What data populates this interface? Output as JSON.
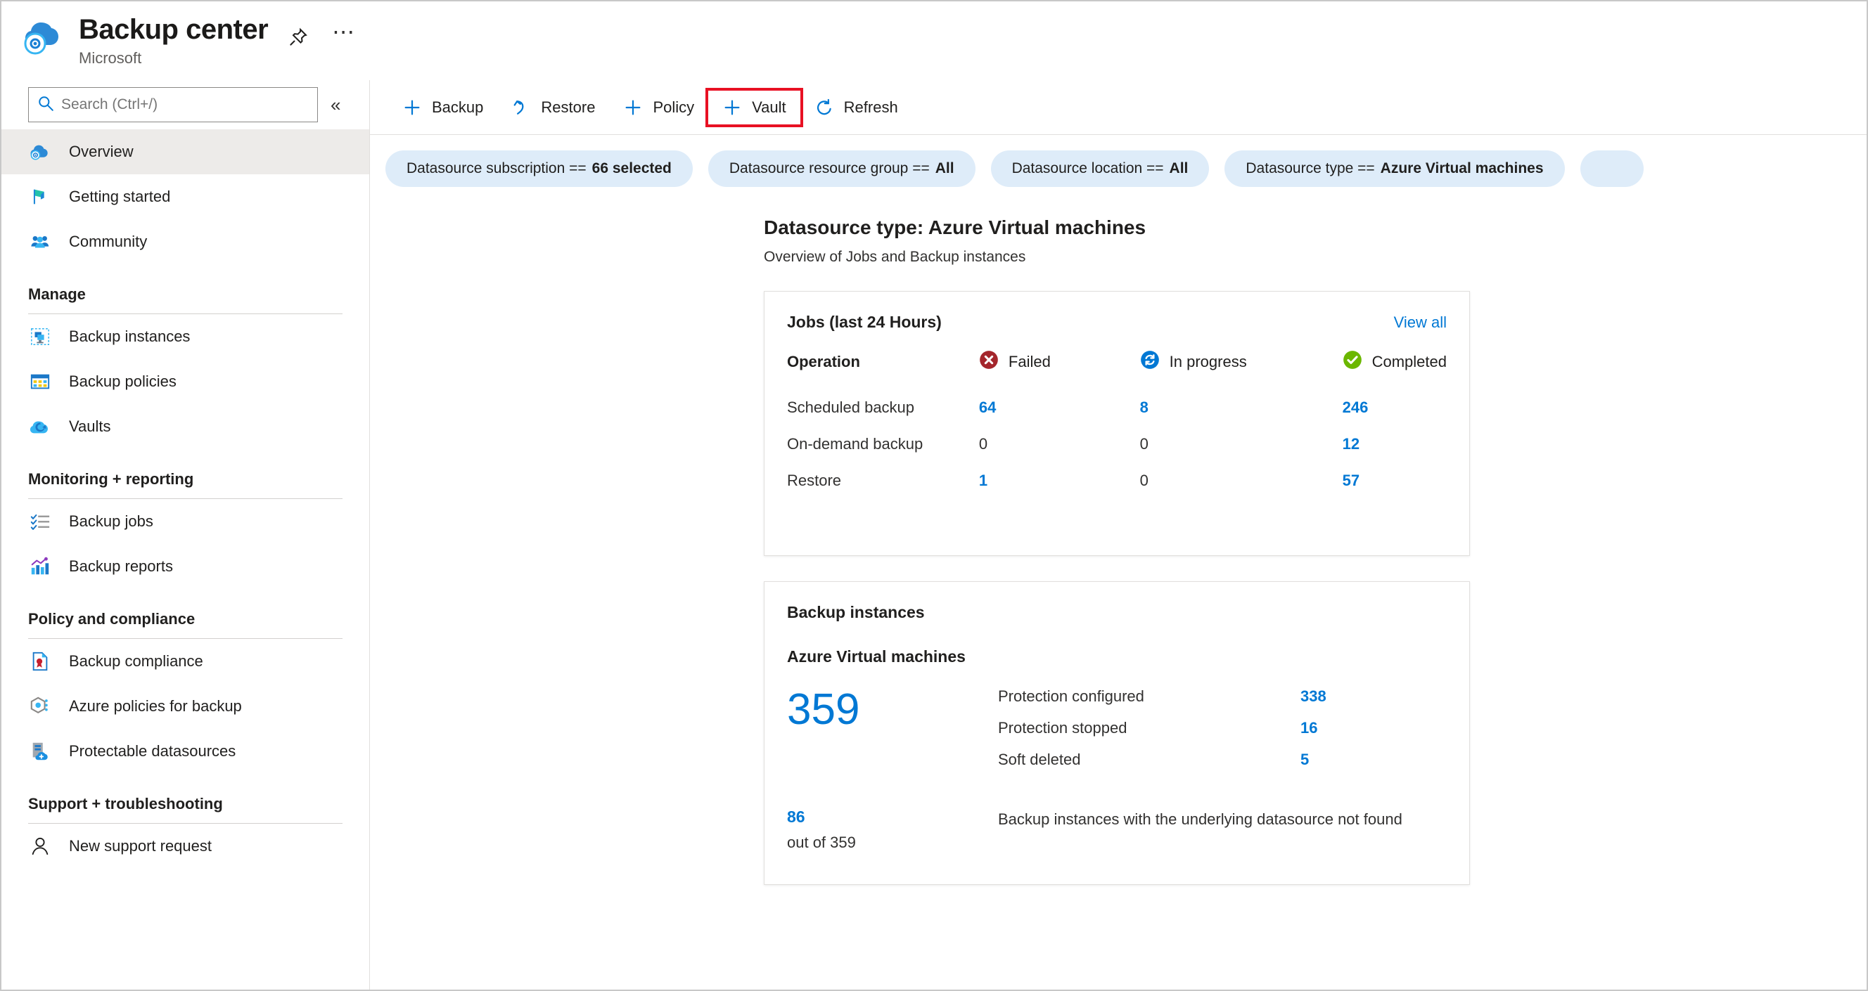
{
  "header": {
    "title": "Backup center",
    "subtitle": "Microsoft",
    "pin_icon": "pin-icon",
    "more_icon": "ellipsis-icon",
    "logo_icon": "backup-center-logo-icon"
  },
  "sidebar": {
    "search": {
      "placeholder": "Search (Ctrl+/)",
      "value": "",
      "icon": "search-icon"
    },
    "collapse_label": "«",
    "top_items": [
      {
        "label": "Overview",
        "icon": "backup-center-cloud-icon",
        "active": true
      },
      {
        "label": "Getting started",
        "icon": "flag-icon",
        "active": false
      },
      {
        "label": "Community",
        "icon": "people-icon",
        "active": false
      }
    ],
    "groups": [
      {
        "title": "Manage",
        "items": [
          {
            "label": "Backup instances",
            "icon": "backup-instances-icon"
          },
          {
            "label": "Backup policies",
            "icon": "backup-policies-icon"
          },
          {
            "label": "Vaults",
            "icon": "vault-cloud-icon"
          }
        ]
      },
      {
        "title": "Monitoring + reporting",
        "items": [
          {
            "label": "Backup jobs",
            "icon": "checklist-icon"
          },
          {
            "label": "Backup reports",
            "icon": "bar-chart-icon"
          }
        ]
      },
      {
        "title": "Policy and compliance",
        "items": [
          {
            "label": "Backup compliance",
            "icon": "compliance-document-icon"
          },
          {
            "label": "Azure policies for backup",
            "icon": "azure-policy-icon"
          },
          {
            "label": "Protectable datasources",
            "icon": "protectable-datasource-icon"
          }
        ]
      },
      {
        "title": "Support + troubleshooting",
        "items": [
          {
            "label": "New support request",
            "icon": "support-person-icon"
          }
        ]
      }
    ]
  },
  "toolbar": {
    "buttons": [
      {
        "label": "Backup",
        "icon": "plus-icon",
        "highlighted": false
      },
      {
        "label": "Restore",
        "icon": "undo-arrow-icon",
        "highlighted": false
      },
      {
        "label": "Policy",
        "icon": "plus-icon",
        "highlighted": false
      },
      {
        "label": "Vault",
        "icon": "plus-icon",
        "highlighted": true
      },
      {
        "label": "Refresh",
        "icon": "refresh-icon",
        "highlighted": false
      }
    ],
    "highlight_color": "#e81123"
  },
  "filters": [
    {
      "label": "Datasource subscription ==",
      "value": "66 selected"
    },
    {
      "label": "Datasource resource group ==",
      "value": "All"
    },
    {
      "label": "Datasource location ==",
      "value": "All"
    },
    {
      "label": "Datasource type ==",
      "value": "Azure Virtual machines"
    },
    {
      "label": "",
      "value": ""
    }
  ],
  "content": {
    "title": "Datasource type: Azure Virtual machines",
    "subtitle": "Overview of Jobs and Backup instances"
  },
  "jobs_card": {
    "title": "Jobs (last 24 Hours)",
    "view_all": "View all",
    "columns": [
      {
        "label": "Operation",
        "icon": ""
      },
      {
        "label": "Failed",
        "icon": "failed-icon",
        "color": "#a4262c"
      },
      {
        "label": "In progress",
        "icon": "in-progress-icon",
        "color": "#0078d4"
      },
      {
        "label": "Completed",
        "icon": "completed-icon",
        "color": "#6bb700"
      }
    ],
    "rows": [
      {
        "operation": "Scheduled backup",
        "failed": "64",
        "in_progress": "8",
        "completed": "246"
      },
      {
        "operation": "On-demand backup",
        "failed": "0",
        "in_progress": "0",
        "completed": "12"
      },
      {
        "operation": "Restore",
        "failed": "1",
        "in_progress": "0",
        "completed": "57"
      }
    ]
  },
  "instances_card": {
    "title": "Backup instances",
    "datasource_type": "Azure Virtual machines",
    "total": "359",
    "metrics": [
      {
        "label": "Protection configured",
        "value": "338"
      },
      {
        "label": "Protection stopped",
        "value": "16"
      },
      {
        "label": "Soft deleted",
        "value": "5"
      }
    ],
    "footer": {
      "count": "86",
      "out_of": "out of 359",
      "description": "Backup instances with the underlying datasource not found"
    }
  },
  "chart_data": {
    "type": "table",
    "title": "Jobs (last 24 Hours)",
    "categories": [
      "Scheduled backup",
      "On-demand backup",
      "Restore"
    ],
    "series": [
      {
        "name": "Failed",
        "values": [
          64,
          0,
          1
        ]
      },
      {
        "name": "In progress",
        "values": [
          8,
          0,
          0
        ]
      },
      {
        "name": "Completed",
        "values": [
          246,
          12,
          57
        ]
      }
    ],
    "secondary": {
      "title": "Backup instances — Azure Virtual machines",
      "total": 359,
      "categories": [
        "Protection configured",
        "Protection stopped",
        "Soft deleted"
      ],
      "values": [
        338,
        16,
        5
      ],
      "datasource_not_found": 86
    }
  }
}
